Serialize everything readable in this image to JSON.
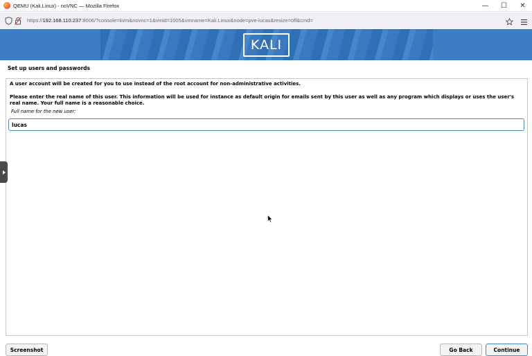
{
  "window": {
    "title": "QEMU (Kali.Linux) - noVNC — Mozilla Firefox",
    "controls": {
      "minimize": "—",
      "maximize": "☐",
      "close": "✕"
    }
  },
  "browser": {
    "url_prefix": "https://",
    "url_host": "192.168.110.237",
    "url_rest": ":8006/?console=kvm&novnc=1&vmid=1005&vmname=Kali.Linux&node=pve-lucas&resize=off&cmd=",
    "icons": [
      "shield-icon",
      "lock-icon",
      "bookmark-star-icon",
      "menu-icon"
    ]
  },
  "banner": {
    "logo_text": "KALI",
    "colors": {
      "primary": "#3d7dc4"
    }
  },
  "installer": {
    "section_title": "Set up users and passwords",
    "intro": "A user account will be created for you to use instead of the root account for non-administrative activities.",
    "explanation": "Please enter the real name of this user. This information will be used for instance as default origin for emails sent by this user as well as any program which displays or uses the user's real name. Your full name is a reasonable choice.",
    "field_label": "Full name for the new user:",
    "field_value": "lucas"
  },
  "buttons": {
    "screenshot": "Screenshot",
    "go_back": "Go Back",
    "continue": "Continue"
  }
}
